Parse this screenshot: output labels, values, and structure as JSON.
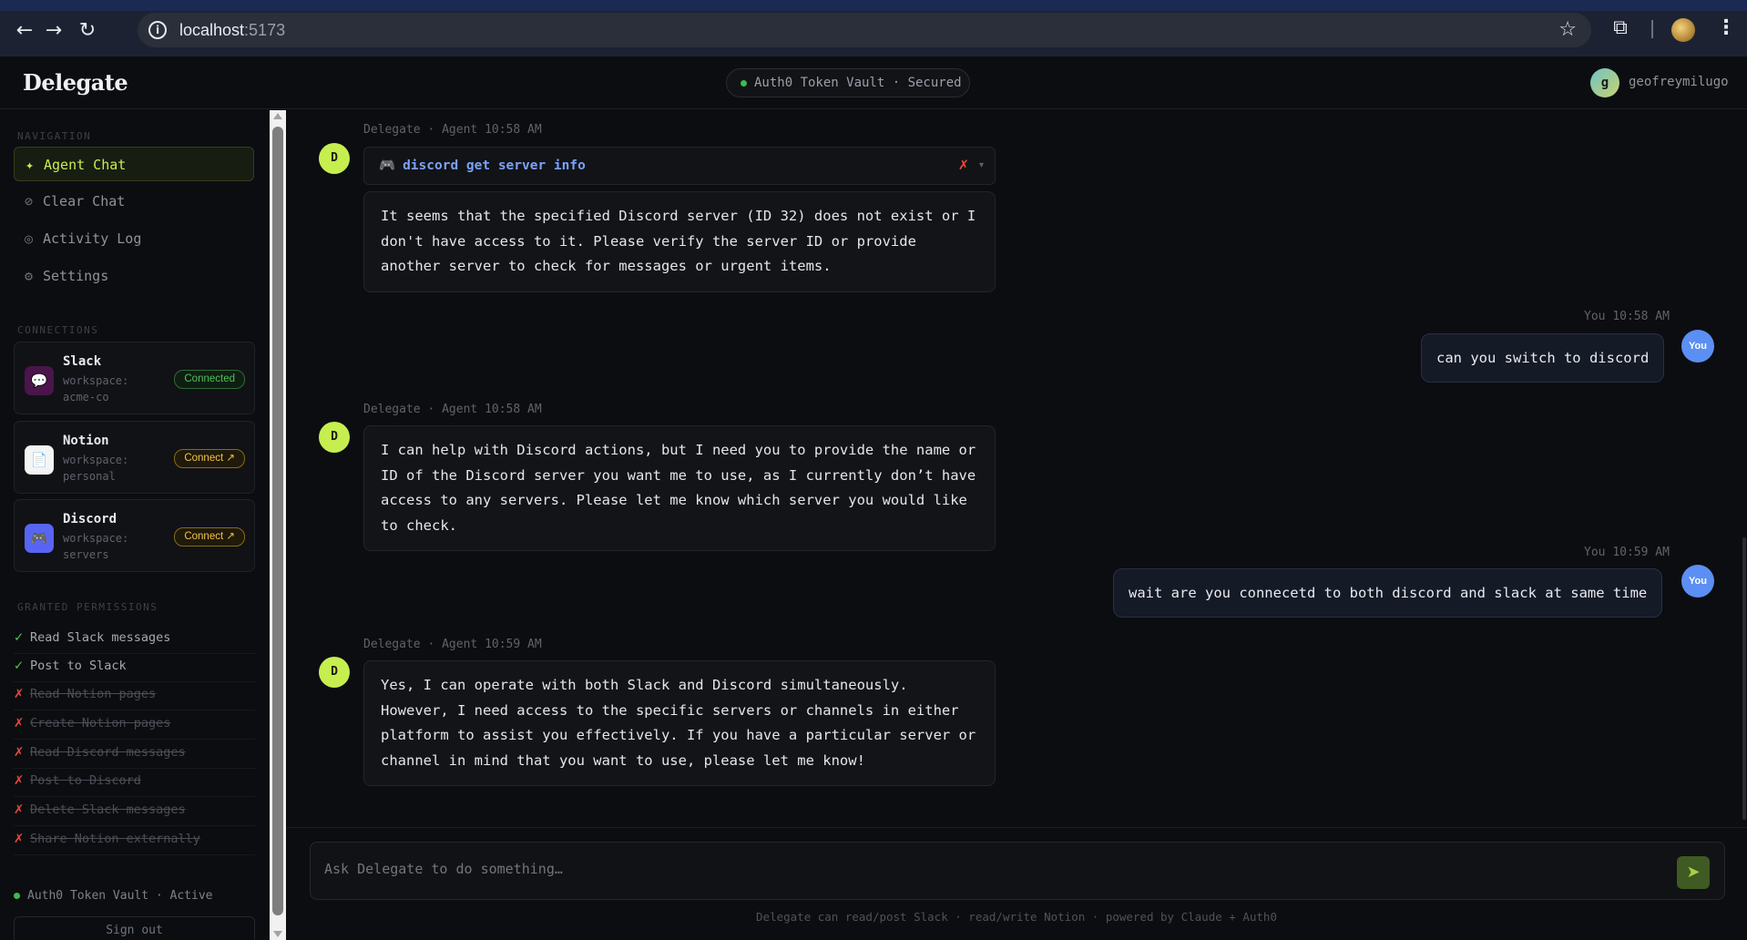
{
  "browser": {
    "url_host": "localhost",
    "url_port": ":5173",
    "back_icon": "arrow-left-icon",
    "forward_icon": "arrow-right-icon",
    "reload_icon": "reload-icon"
  },
  "header": {
    "logo": "Delegate",
    "vault_status": "Auth0 Token Vault · Secured",
    "user_initial": "g",
    "user_name": "geofreymilugo"
  },
  "sidebar": {
    "nav_label": "NAVIGATION",
    "nav_items": [
      {
        "icon": "✦",
        "label": "Agent Chat",
        "active": true
      },
      {
        "icon": "⊘",
        "label": "Clear Chat"
      },
      {
        "icon": "◎",
        "label": "Activity Log"
      },
      {
        "icon": "⚙",
        "label": "Settings"
      }
    ],
    "connections_label": "CONNECTIONS",
    "connections": [
      {
        "name": "Slack",
        "workspace": "workspace: acme-co",
        "status": "Connected",
        "icon": "💬"
      },
      {
        "name": "Notion",
        "workspace": "workspace: personal",
        "status": "Connect ↗",
        "icon": "📄"
      },
      {
        "name": "Discord",
        "workspace": "workspace: servers",
        "status": "Connect ↗",
        "icon": "🎮"
      }
    ],
    "permissions_label": "GRANTED PERMISSIONS",
    "permissions": [
      {
        "label": "Read Slack messages",
        "granted": true,
        "mark": "✓"
      },
      {
        "label": "Post to Slack",
        "granted": true,
        "mark": "✓"
      },
      {
        "label": "Read Notion pages",
        "granted": false,
        "mark": "✗"
      },
      {
        "label": "Create Notion pages",
        "granted": false,
        "mark": "✗"
      },
      {
        "label": "Read Discord messages",
        "granted": false,
        "mark": "✗"
      },
      {
        "label": "Post to Discord",
        "granted": false,
        "mark": "✗"
      },
      {
        "label": "Delete Slack messages",
        "granted": false,
        "mark": "✗"
      },
      {
        "label": "Share Notion externally",
        "granted": false,
        "mark": "✗"
      }
    ],
    "vault_footer": "Auth0 Token Vault · Active",
    "sign_out": "Sign out"
  },
  "chat": {
    "messages": [
      {
        "role": "agent",
        "meta": "Delegate · Agent",
        "time": "10:58 AM",
        "avatar": "D",
        "tool_call": {
          "label": "discord get server info",
          "status": "✗",
          "chevron": "▾"
        },
        "text": "It seems that the specified Discord server (ID 32) does not exist or I don't have access to it. Please verify the server ID or provide another server to check for messages or urgent items."
      },
      {
        "role": "user",
        "meta": "You",
        "time": "10:58 AM",
        "avatar": "You",
        "text": "can you switch to discord"
      },
      {
        "role": "agent",
        "meta": "Delegate · Agent",
        "time": "10:58 AM",
        "avatar": "D",
        "text": "I can help with Discord actions, but I need you to provide the name or ID of the Discord server you want me to use, as I currently don’t have access to any servers. Please let me know which server you would like to check."
      },
      {
        "role": "user",
        "meta": "You",
        "time": "10:59 AM",
        "avatar": "You",
        "text": "wait are you connecetd to both discord and slack at same time"
      },
      {
        "role": "agent",
        "meta": "Delegate · Agent",
        "time": "10:59 AM",
        "avatar": "D",
        "text": "Yes, I can operate with both Slack and Discord simultaneously. However, I need access to the specific servers or channels in either platform to assist you effectively. If you have a particular server or channel in mind that you want to use, please let me know!"
      }
    ]
  },
  "composer": {
    "placeholder": "Ask Delegate to do something…",
    "send_icon": "send-icon",
    "footer": "Delegate can read/post Slack · read/write Notion · powered by Claude + Auth0"
  }
}
